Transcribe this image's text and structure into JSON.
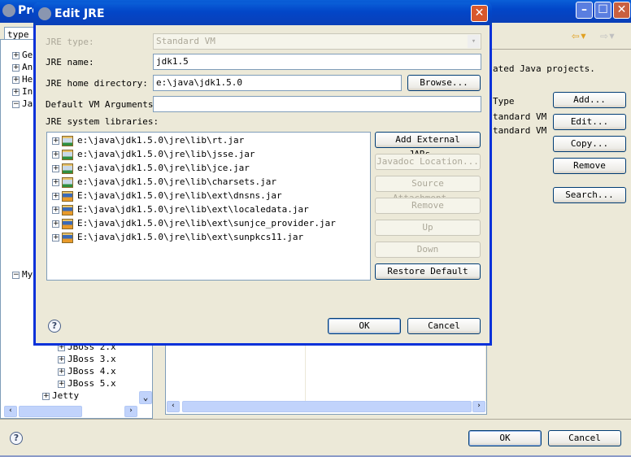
{
  "main_window": {
    "title": "Pre",
    "filter_value": "type :",
    "description_visible": "ated Java projects.",
    "tree_top": [
      "Ge",
      "An",
      "He",
      "In",
      "Ja"
    ],
    "tree_my": "My",
    "tree_bottom": [
      "JBoss  2.x",
      "JBoss  3.x",
      "JBoss  4.x",
      "JBoss  5.x",
      "Jetty"
    ],
    "table_header_type": "Type",
    "table_rows": [
      "tandard VM",
      "tandard VM"
    ],
    "buttons": {
      "add": "Add...",
      "edit": "Edit...",
      "copy": "Copy...",
      "remove": "Remove",
      "search": "Search..."
    },
    "ok": "OK",
    "cancel": "Cancel"
  },
  "dialog": {
    "title": "Edit JRE",
    "jre_type_label": "JRE type:",
    "jre_type_value": "Standard VM",
    "jre_name_label": "JRE name:",
    "jre_name_value": "jdk1.5",
    "home_label": "JRE home directory:",
    "home_value": "e:\\java\\jdk1.5.0",
    "browse": "Browse...",
    "vm_args_label": "Default VM Arguments:",
    "vm_args_value": "",
    "libs_label": "JRE system libraries:",
    "libraries": [
      {
        "path": "e:\\java\\jdk1.5.0\\jre\\lib\\rt.jar",
        "icon": "jar-icon"
      },
      {
        "path": "e:\\java\\jdk1.5.0\\jre\\lib\\jsse.jar",
        "icon": "jar-icon"
      },
      {
        "path": "e:\\java\\jdk1.5.0\\jre\\lib\\jce.jar",
        "icon": "jar-icon"
      },
      {
        "path": "e:\\java\\jdk1.5.0\\jre\\lib\\charsets.jar",
        "icon": "jar-icon"
      },
      {
        "path": "E:\\java\\jdk1.5.0\\jre\\lib\\ext\\dnsns.jar",
        "icon": "ext-jar-icon"
      },
      {
        "path": "E:\\java\\jdk1.5.0\\jre\\lib\\ext\\localedata.jar",
        "icon": "ext-jar-icon"
      },
      {
        "path": "E:\\java\\jdk1.5.0\\jre\\lib\\ext\\sunjce_provider.jar",
        "icon": "ext-jar-icon"
      },
      {
        "path": "E:\\java\\jdk1.5.0\\jre\\lib\\ext\\sunpkcs11.jar",
        "icon": "ext-jar-icon"
      }
    ],
    "lib_buttons": [
      {
        "label": "Add External JARs...",
        "enabled": true
      },
      {
        "label": "Javadoc Location...",
        "enabled": false
      },
      {
        "label": "Source Attachment...",
        "enabled": false
      },
      {
        "label": "Remove",
        "enabled": false
      },
      {
        "label": "Up",
        "enabled": false
      },
      {
        "label": "Down",
        "enabled": false
      },
      {
        "label": "Restore Default",
        "enabled": true
      }
    ],
    "ok": "OK",
    "cancel": "Cancel"
  }
}
